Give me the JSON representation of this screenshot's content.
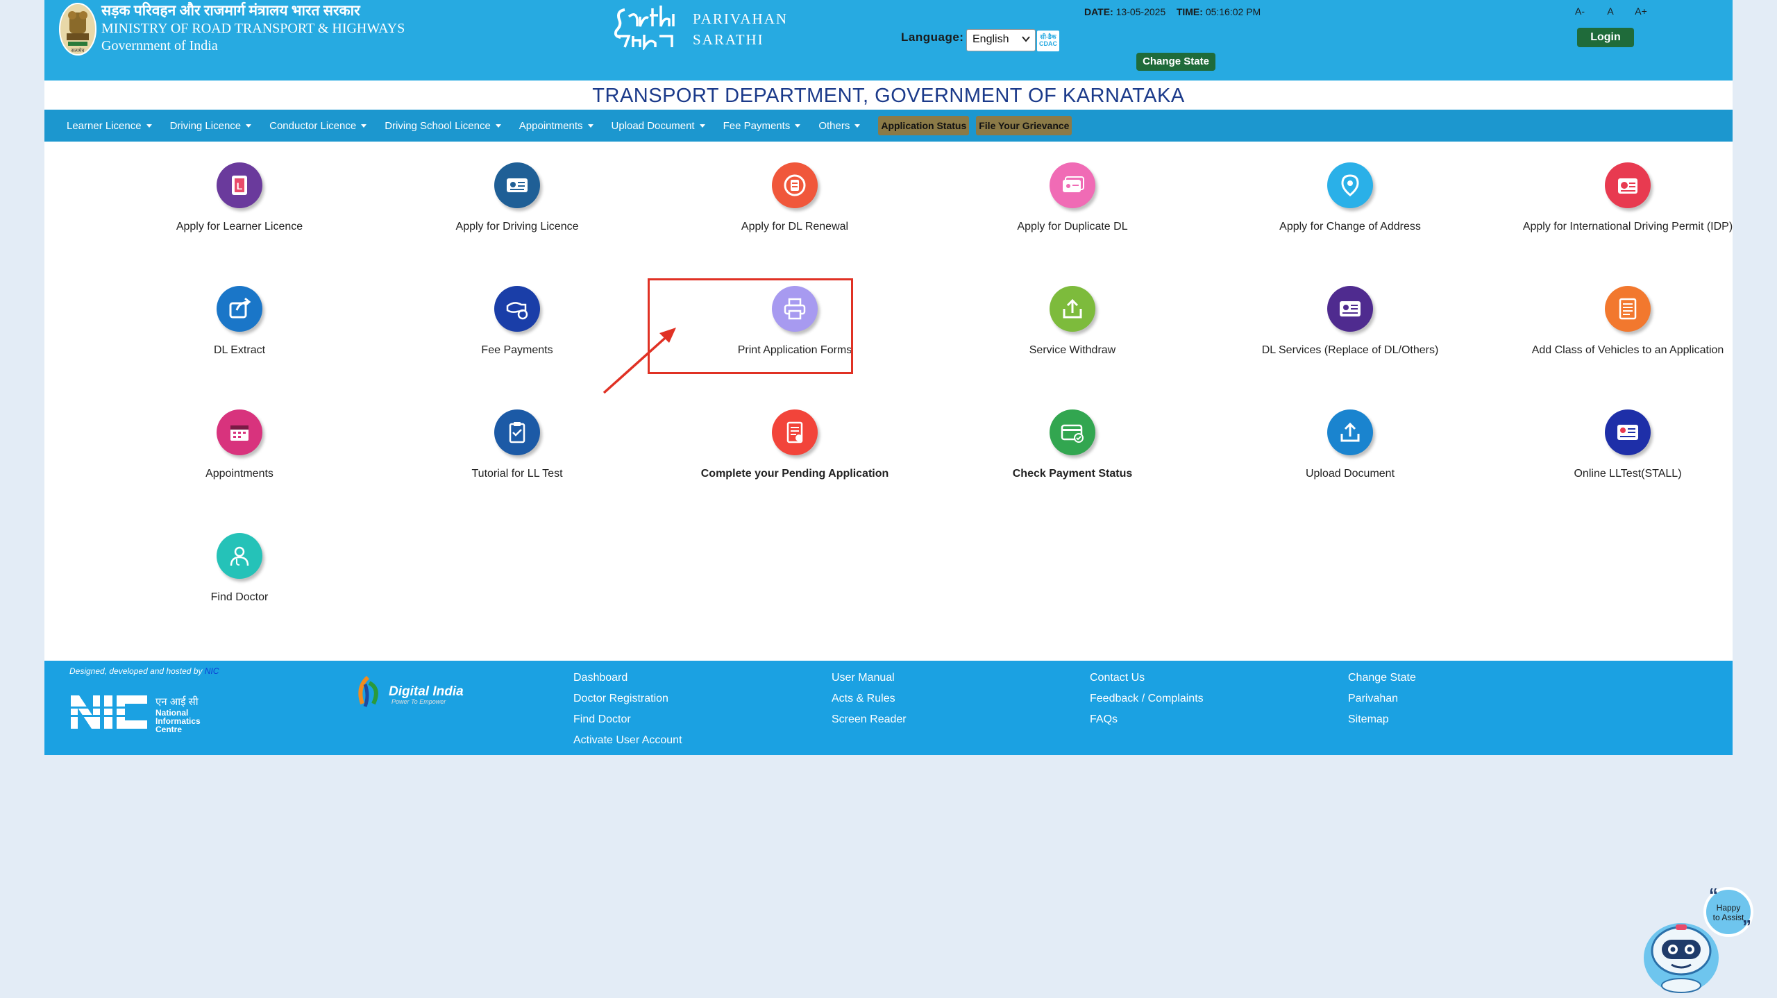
{
  "header": {
    "ministry_hindi": "सड़क परिवहन और राजमार्ग मंत्रालय भारत सरकार",
    "ministry_english": "MINISTRY OF ROAD TRANSPORT & HIGHWAYS",
    "government": "Government of India",
    "brand_line1": "PARIVAHAN",
    "brand_line2": "SARATHI",
    "language_label": "Language:",
    "language_value": "English",
    "cdac_label": "सी-डैक CDAC",
    "date_label": "DATE:",
    "date_value": "13-05-2025",
    "time_label": "TIME:",
    "time_value": "05:16:02 PM",
    "change_state": "Change State",
    "font_small": "A-",
    "font_normal": "A",
    "font_large": "A+",
    "login": "Login"
  },
  "department_title": "TRANSPORT DEPARTMENT, GOVERNMENT OF KARNATAKA",
  "nav": {
    "items": [
      "Learner Licence",
      "Driving Licence",
      "Conductor Licence",
      "Driving School Licence",
      "Appointments",
      "Upload Document",
      "Fee Payments",
      "Others"
    ],
    "application_status": "Application Status",
    "grievance": "File Your Grievance"
  },
  "services": [
    {
      "label": "Apply for Learner Licence",
      "color": "#6a3a9c",
      "icon": "learner-licence-icon"
    },
    {
      "label": "Apply for Driving Licence",
      "color": "#1f5f96",
      "icon": "driving-licence-icon"
    },
    {
      "label": "Apply for DL Renewal",
      "color": "#f0573b",
      "icon": "dl-renewal-icon"
    },
    {
      "label": "Apply for Duplicate DL",
      "color": "#f06bb5",
      "icon": "duplicate-dl-icon"
    },
    {
      "label": "Apply for Change of Address",
      "color": "#2ab0e8",
      "icon": "location-pin-icon"
    },
    {
      "label": "Apply for International Driving Permit (IDP)",
      "color": "#e83a50",
      "icon": "idp-icon"
    },
    {
      "label": "DL Extract",
      "color": "#1a76c8",
      "icon": "share-icon"
    },
    {
      "label": "Fee Payments",
      "color": "#1a3ea8",
      "icon": "fee-payment-icon"
    },
    {
      "label": "Print Application Forms",
      "color": "#a79af0",
      "icon": "printer-icon"
    },
    {
      "label": "Service Withdraw",
      "color": "#7dbb3c",
      "icon": "withdraw-icon"
    },
    {
      "label": "DL Services (Replace of DL/Others)",
      "color": "#4f2b8f",
      "icon": "dl-services-icon"
    },
    {
      "label": "Add Class of Vehicles to an Application",
      "color": "#f2782e",
      "icon": "vehicle-class-icon"
    },
    {
      "label": "Appointments",
      "color": "#d8337d",
      "icon": "calendar-icon"
    },
    {
      "label": "Tutorial for LL Test",
      "color": "#1c5aa6",
      "icon": "clipboard-icon"
    },
    {
      "label": "Complete your Pending Application",
      "color": "#f2443a",
      "icon": "pending-application-icon"
    },
    {
      "label": "Check Payment Status",
      "color": "#32a650",
      "icon": "payment-status-icon"
    },
    {
      "label": "Upload Document",
      "color": "#1a84cf",
      "icon": "upload-icon"
    },
    {
      "label": "Online LLTest(STALL)",
      "color": "#1e2fa8",
      "icon": "online-test-icon"
    },
    {
      "label": "Find Doctor",
      "color": "#25c2b8",
      "icon": "doctor-icon"
    }
  ],
  "footer": {
    "designed_by": "Designed, developed and hosted by",
    "nic_small": "NIC",
    "nic_hindi": "एन आई सी",
    "nic_name_1": "National",
    "nic_name_2": "Informatics",
    "nic_name_3": "Centre",
    "digital_india": "Digital India",
    "digital_india_tag": "Power To Empower",
    "col1": [
      "Dashboard",
      "Doctor Registration",
      "Find Doctor",
      "Activate User Account"
    ],
    "col2": [
      "User Manual",
      "Acts & Rules",
      "Screen Reader"
    ],
    "col3": [
      "Contact Us",
      "Feedback / Complaints",
      "FAQs"
    ],
    "col4": [
      "Change State",
      "Parivahan",
      "Sitemap"
    ]
  },
  "assistant": {
    "line1": "Happy",
    "line2": "to Assist"
  }
}
